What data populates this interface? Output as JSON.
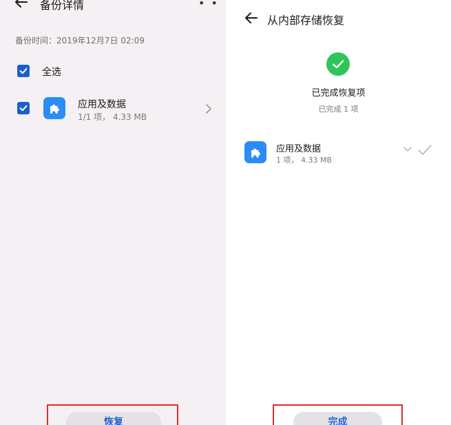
{
  "left": {
    "title": "备份详情",
    "backup_time": "备份时间：2019年12月7日 02:09",
    "select_all": "全选",
    "item": {
      "name": "应用及数据",
      "detail": "1/1 项， 4.33 MB",
      "icon": "puzzle-icon"
    },
    "restore_button": "恢复"
  },
  "right": {
    "title": "从内部存储恢复",
    "status_title": "已完成恢复项",
    "status_sub": "已完成 1 项",
    "item": {
      "name": "应用及数据",
      "detail": "1 项， 4.33 MB",
      "icon": "puzzle-icon"
    },
    "done_button": "完成"
  },
  "colors": {
    "accent": "#1a5fcc",
    "app_icon": "#2a8cf7",
    "success": "#2fc55b",
    "highlight_box": "#e02a2a"
  }
}
